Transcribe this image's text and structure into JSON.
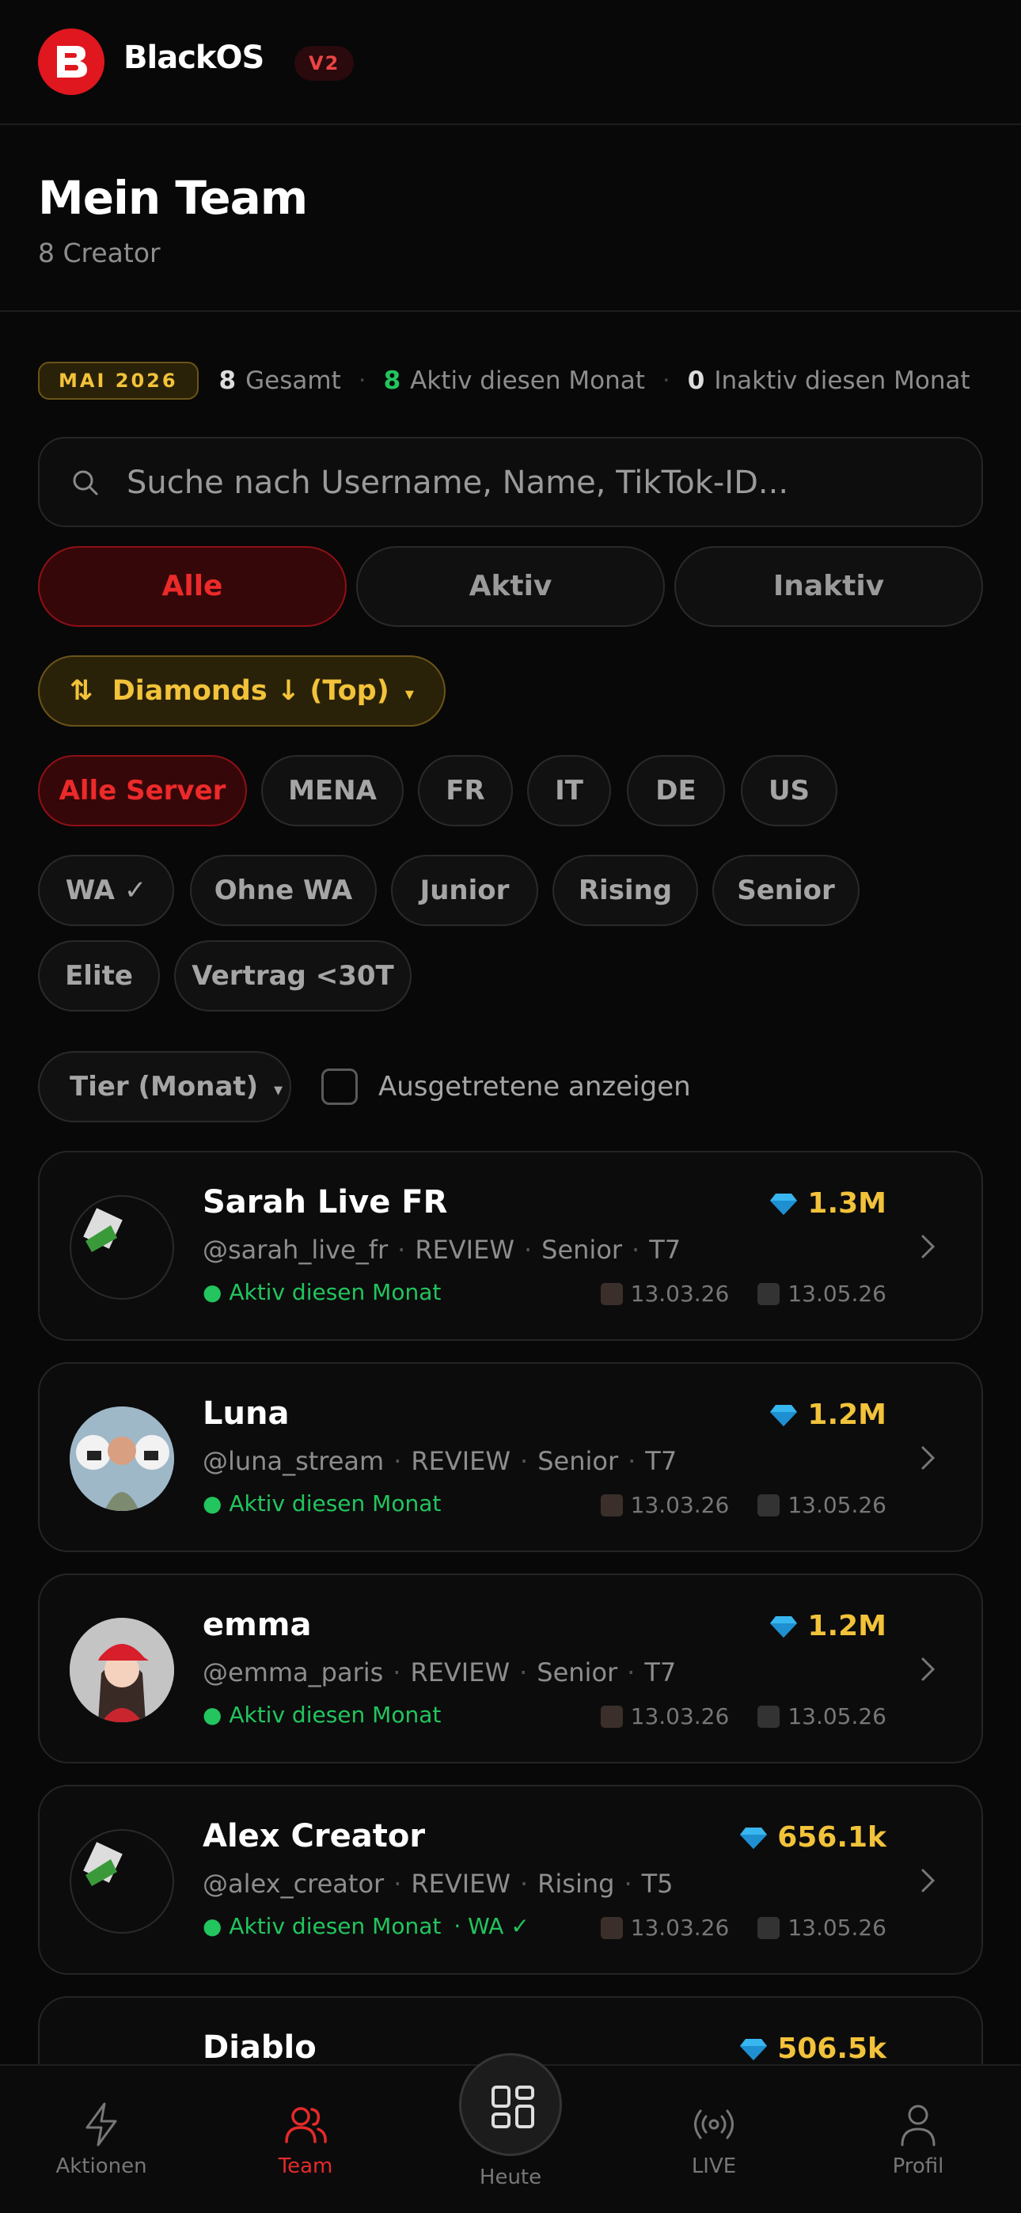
{
  "header": {
    "brand": "BlackOS",
    "version": "V2"
  },
  "page": {
    "title": "Mein Team",
    "subtitle": "8 Creator"
  },
  "stats": {
    "month": "MAI 2026",
    "total_count": "8",
    "total_label": "Gesamt",
    "active_count": "8",
    "active_label": "Aktiv diesen Monat",
    "inactive_count": "0",
    "inactive_label": "Inaktiv diesen Monat"
  },
  "search": {
    "placeholder": "Suche nach Username, Name, TikTok-ID..."
  },
  "segments": [
    {
      "label": "Alle",
      "active": true
    },
    {
      "label": "Aktiv",
      "active": false
    },
    {
      "label": "Inaktiv",
      "active": false
    }
  ],
  "sort": {
    "label": "Diamonds ↓ (Top)"
  },
  "server_chips": [
    "Alle Server",
    "MENA",
    "FR",
    "IT",
    "DE",
    "US"
  ],
  "filter_chips": [
    "WA ✓",
    "Ohne WA",
    "Junior",
    "Rising",
    "Senior",
    "Elite",
    "Vertrag <30T"
  ],
  "tier_dropdown": {
    "label": "Tier (Monat)"
  },
  "show_left": {
    "label": "Ausgetretene anzeigen",
    "checked": false
  },
  "creators": [
    {
      "name": "Sarah Live FR",
      "handle": "@sarah_live_fr",
      "status_tag": "REVIEW",
      "level": "Senior",
      "tier": "T7",
      "diamonds": "1.3M",
      "activity": "● Aktiv diesen Monat",
      "wa": "",
      "date_start": "13.03.26",
      "date_end": "13.05.26"
    },
    {
      "name": "Luna",
      "handle": "@luna_stream",
      "status_tag": "REVIEW",
      "level": "Senior",
      "tier": "T7",
      "diamonds": "1.2M",
      "activity": "● Aktiv diesen Monat",
      "wa": "",
      "date_start": "13.03.26",
      "date_end": "13.05.26"
    },
    {
      "name": "emma",
      "handle": "@emma_paris",
      "status_tag": "REVIEW",
      "level": "Senior",
      "tier": "T7",
      "diamonds": "1.2M",
      "activity": "● Aktiv diesen Monat",
      "wa": "",
      "date_start": "13.03.26",
      "date_end": "13.05.26"
    },
    {
      "name": "Alex Creator",
      "handle": "@alex_creator",
      "status_tag": "REVIEW",
      "level": "Rising",
      "tier": "T5",
      "diamonds": "656.1k",
      "activity": "● Aktiv diesen Monat",
      "wa": "· WA ✓",
      "date_start": "13.03.26",
      "date_end": "13.05.26"
    },
    {
      "name": "Diablo",
      "diamonds": "506.5k"
    }
  ],
  "nav": [
    {
      "label": "Aktionen",
      "icon": "bolt-icon"
    },
    {
      "label": "Team",
      "icon": "users-icon",
      "active": true
    },
    {
      "label": "Heute",
      "icon": "grid-icon"
    },
    {
      "label": "LIVE",
      "icon": "broadcast-icon"
    },
    {
      "label": "Profil",
      "icon": "user-icon"
    }
  ],
  "colors": {
    "accent_red": "#e0171f",
    "gold": "#f2c23a",
    "green": "#22c55e",
    "background": "#080808"
  }
}
